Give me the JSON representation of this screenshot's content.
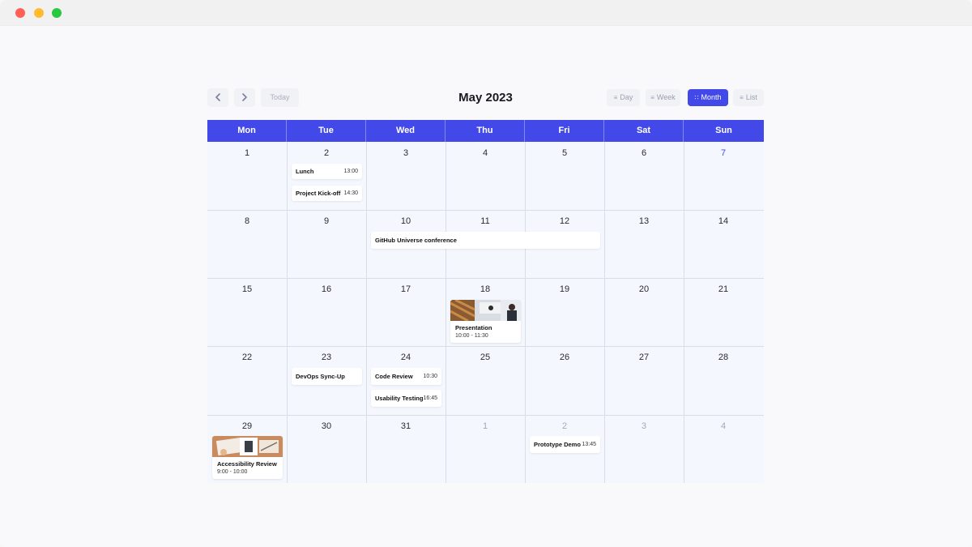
{
  "window": {
    "buttons": [
      "close",
      "minimize",
      "zoom"
    ]
  },
  "toolbar": {
    "prev_icon": "chevron-left-icon",
    "next_icon": "chevron-right-icon",
    "today_label": "Today",
    "title": "May 2023",
    "views": [
      {
        "id": "day",
        "label": "Day",
        "icon": "list-icon",
        "active": false
      },
      {
        "id": "week",
        "label": "Week",
        "icon": "list-icon",
        "active": false
      },
      {
        "id": "month",
        "label": "Month",
        "icon": "grid-icon",
        "active": true
      },
      {
        "id": "list",
        "label": "List",
        "icon": "lines-icon",
        "active": false
      }
    ]
  },
  "colors": {
    "accent": "#4249e8",
    "cell_bg": "#f4f7fd",
    "grid": "#d9dde6"
  },
  "calendar": {
    "weekdays": [
      "Mon",
      "Tue",
      "Wed",
      "Thu",
      "Fri",
      "Sat",
      "Sun"
    ],
    "weeks": [
      [
        "1",
        "2",
        "3",
        "4",
        "5",
        "6",
        "7"
      ],
      [
        "8",
        "9",
        "10",
        "11",
        "12",
        "13",
        "14"
      ],
      [
        "15",
        "16",
        "17",
        "18",
        "19",
        "20",
        "21"
      ],
      [
        "22",
        "23",
        "24",
        "25",
        "26",
        "27",
        "28"
      ],
      [
        "29",
        "30",
        "31",
        "1",
        "2",
        "3",
        "4"
      ]
    ],
    "events": {
      "lunch": {
        "title": "Lunch",
        "time": "13:00"
      },
      "kickoff": {
        "title": "Project Kick-off",
        "time": "14:30"
      },
      "github": {
        "title": "GitHub Universe conference"
      },
      "presentation": {
        "title": "Presentation",
        "time": "10:00 - 11:30"
      },
      "devops": {
        "title": "DevOps Sync-Up"
      },
      "codereview": {
        "title": "Code Review",
        "time": "10:30"
      },
      "usability": {
        "title": "Usability Testing",
        "time": "16:45"
      },
      "accessibility": {
        "title": "Accessibility Review",
        "time": "9:00 - 10:00"
      },
      "prototype": {
        "title": "Prototype Demo",
        "time": "13:45"
      }
    }
  }
}
